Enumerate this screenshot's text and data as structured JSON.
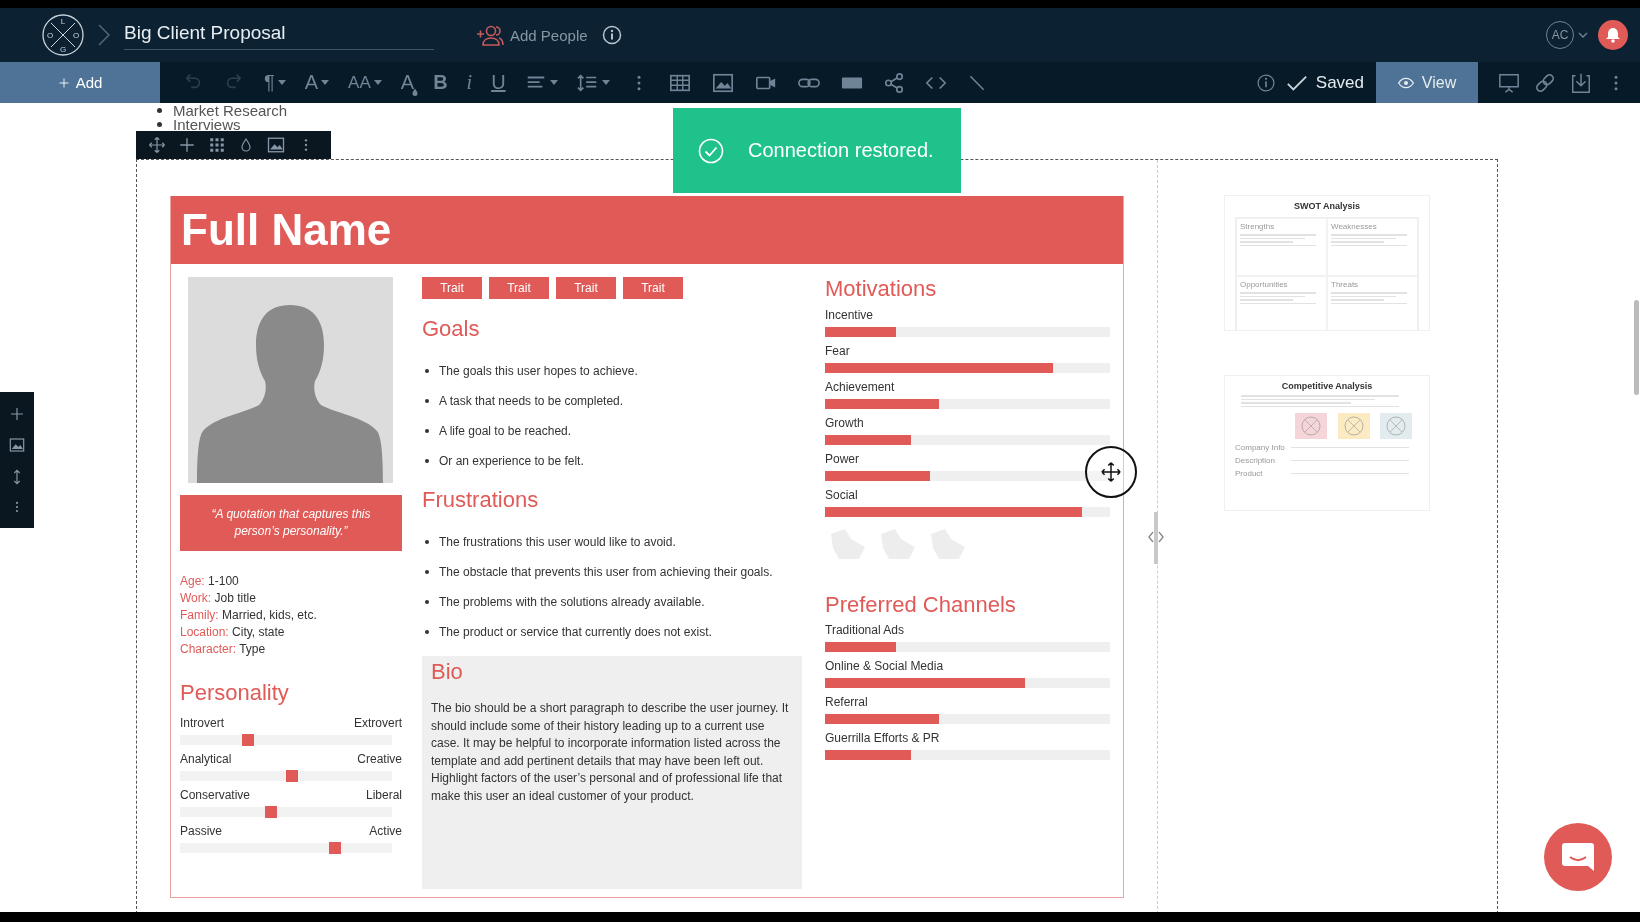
{
  "header": {
    "logo_letters": [
      "L",
      "O",
      "G",
      "O"
    ],
    "title": "Big Client Proposal",
    "add_people": "Add People",
    "avatar": "AC"
  },
  "toolbar": {
    "add": "Add",
    "glyphs": [
      "¶",
      "A",
      "AA",
      "A",
      "B",
      "i",
      "U"
    ],
    "status": "Saved",
    "view": "View"
  },
  "outline": [
    "Market Research",
    "Interviews"
  ],
  "toast": {
    "message": "Connection restored."
  },
  "persona": {
    "name": "Full Name",
    "traits": [
      "Trait",
      "Trait",
      "Trait",
      "Trait"
    ],
    "quote": "“A quotation that captures this person’s personality.”",
    "details": [
      {
        "label": "Age:",
        "value": "1-100"
      },
      {
        "label": "Work:",
        "value": "Job title"
      },
      {
        "label": "Family:",
        "value": "Married, kids, etc."
      },
      {
        "label": "Location:",
        "value": "City, state"
      },
      {
        "label": "Character:",
        "value": "Type"
      }
    ],
    "personality": {
      "heading": "Personality",
      "sliders": [
        {
          "left": "Introvert",
          "right": "Extrovert",
          "level": 0.32
        },
        {
          "left": "Analytical",
          "right": "Creative",
          "level": 0.53
        },
        {
          "left": "Conservative",
          "right": "Liberal",
          "level": 0.43
        },
        {
          "left": "Passive",
          "right": "Active",
          "level": 0.73
        }
      ]
    },
    "goals": {
      "heading": "Goals",
      "items": [
        "The goals this user hopes to achieve.",
        "A task that needs to be completed.",
        "A life goal to be reached.",
        "Or an experience to be felt."
      ]
    },
    "frustrations": {
      "heading": "Frustrations",
      "items": [
        "The frustrations this user would like to avoid.",
        "The obstacle that prevents this user from achieving their goals.",
        "The problems with the solutions already available.",
        "The product or service that currently does not exist."
      ]
    },
    "bio": {
      "heading": "Bio",
      "text": "The bio should be a short paragraph to describe the user journey. It should include some of their history leading up to a current use case. It may be helpful to incorporate information listed across the template and add pertinent details that may have been left out. Highlight factors of the user’s personal and of professional life that make this user an ideal customer of your product."
    },
    "motivations": {
      "heading": "Motivations",
      "bars": [
        {
          "label": "Incentive",
          "level": 0.25
        },
        {
          "label": "Fear",
          "level": 0.8
        },
        {
          "label": "Achievement",
          "level": 0.4
        },
        {
          "label": "Growth",
          "level": 0.3
        },
        {
          "label": "Power",
          "level": 0.37
        },
        {
          "label": "Social",
          "level": 0.9
        }
      ]
    },
    "channels": {
      "heading": "Preferred Channels",
      "bars": [
        {
          "label": "Traditional Ads",
          "level": 0.25
        },
        {
          "label": "Online & Social Media",
          "level": 0.7
        },
        {
          "label": "Referral",
          "level": 0.4
        },
        {
          "label": "Guerrilla Efforts & PR",
          "level": 0.3
        }
      ]
    }
  },
  "thumbnails": [
    {
      "kind": "swot",
      "title": "SWOT Analysis",
      "sections": [
        "Strengths",
        "Weaknesses",
        "Opportunities",
        "Threats"
      ]
    },
    {
      "kind": "competitive",
      "title": "Competitive Analysis",
      "logos": [
        {
          "color": "#f6d5d8"
        },
        {
          "color": "#fbeac2"
        },
        {
          "color": "#e2ecee"
        }
      ],
      "rows": [
        "Company Info",
        "Description",
        "Product"
      ]
    }
  ]
}
